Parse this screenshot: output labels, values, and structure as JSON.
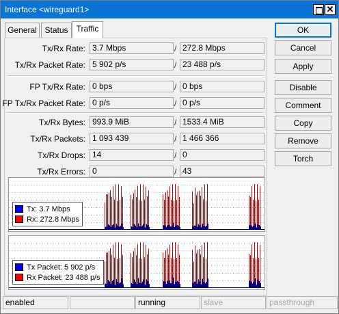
{
  "window": {
    "title": "Interface <wireguard1>",
    "close_glyph": "✕"
  },
  "tabs": [
    {
      "label": "General"
    },
    {
      "label": "Status"
    },
    {
      "label": "Traffic"
    }
  ],
  "fields": {
    "tx_rx_rate": {
      "label": "Tx/Rx Rate:",
      "tx": "3.7 Mbps",
      "rx": "272.8 Mbps"
    },
    "tx_rx_packet_rate": {
      "label": "Tx/Rx Packet Rate:",
      "tx": "5 902 p/s",
      "rx": "23 488 p/s"
    },
    "fp_tx_rx_rate": {
      "label": "FP Tx/Rx Rate:",
      "tx": "0 bps",
      "rx": "0 bps"
    },
    "fp_tx_rx_packet_rate": {
      "label": "FP Tx/Rx Packet Rate:",
      "tx": "0 p/s",
      "rx": "0 p/s"
    },
    "tx_rx_bytes": {
      "label": "Tx/Rx Bytes:",
      "tx": "993.9 MiB",
      "rx": "1533.4 MiB"
    },
    "tx_rx_packets": {
      "label": "Tx/Rx Packets:",
      "tx": "1 093 439",
      "rx": "1 466 366"
    },
    "tx_rx_drops": {
      "label": "Tx/Rx Drops:",
      "tx": "14",
      "rx": "0"
    },
    "tx_rx_errors": {
      "label": "Tx/Rx Errors:",
      "tx": "0",
      "rx": "43"
    }
  },
  "slash": "/",
  "graphs": {
    "rate": {
      "legend": [
        {
          "label": "Tx:  3.7 Mbps",
          "color": "#0000ff"
        },
        {
          "label": "Rx:  272.8 Mbps",
          "color": "#ff0000"
        }
      ]
    },
    "packet": {
      "legend": [
        {
          "label": "Tx Packet:  5 902 p/s",
          "color": "#0000ff"
        },
        {
          "label": "Rx Packet:  23 488 p/s",
          "color": "#ff0000"
        }
      ]
    }
  },
  "buttons": {
    "ok": "OK",
    "cancel": "Cancel",
    "apply": "Apply",
    "disable": "Disable",
    "comment": "Comment",
    "copy": "Copy",
    "remove": "Remove",
    "torch": "Torch"
  },
  "status_bar": {
    "state": "enabled",
    "blank": "",
    "running": "running",
    "slave": "slave",
    "passthrough": "passthrough"
  },
  "colors": {
    "titlebar": "#0a74d6",
    "rx_series": "#c00000",
    "tx_series": "#000080",
    "grid": "#8aa0b0"
  }
}
